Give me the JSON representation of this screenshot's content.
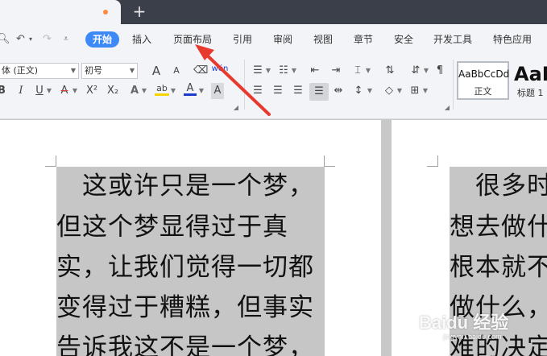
{
  "menu": {
    "items": [
      "开始",
      "插入",
      "页面布局",
      "引用",
      "审阅",
      "视图",
      "章节",
      "安全",
      "开发工具",
      "特色应用"
    ],
    "active_index": 0
  },
  "toolbar": {
    "font_name": "体 (正文)",
    "font_size": "初号",
    "grow_font": "A",
    "shrink_font": "A",
    "bold": "B",
    "italic": "I",
    "strike": "A",
    "superscript": "X²",
    "subscript": "X₂",
    "text_effect": "A",
    "highlight": "ab",
    "font_color": "A",
    "char_shading": "A",
    "phonetic": "wén",
    "styles": [
      {
        "sample": "AaBbCcDd",
        "name": "正文"
      },
      {
        "sample": "AaBb",
        "name": "标题 1"
      }
    ]
  },
  "colors": {
    "accent": "#3d8af7",
    "tab_dot": "#ff8a3d",
    "highlight_yellow": "#f5d400",
    "font_color_blue": "#1a3cc8",
    "arrow_red": "#e8392f",
    "selection_gray": "#c6c6c6"
  },
  "document": {
    "page1_lines": [
      "　这或许只是一个梦，",
      "但这个梦显得过于真",
      "实，让我们觉得一切都",
      "变得过于糟糕，但事实",
      "告诉我这不是一个梦，"
    ],
    "page2_lines": [
      "　很多时",
      "想去做什",
      "根本就不",
      "做什么，",
      "难的决定"
    ]
  },
  "watermark": {
    "logo": "Baidu 经验",
    "url": "jingyan.baidu.com"
  }
}
